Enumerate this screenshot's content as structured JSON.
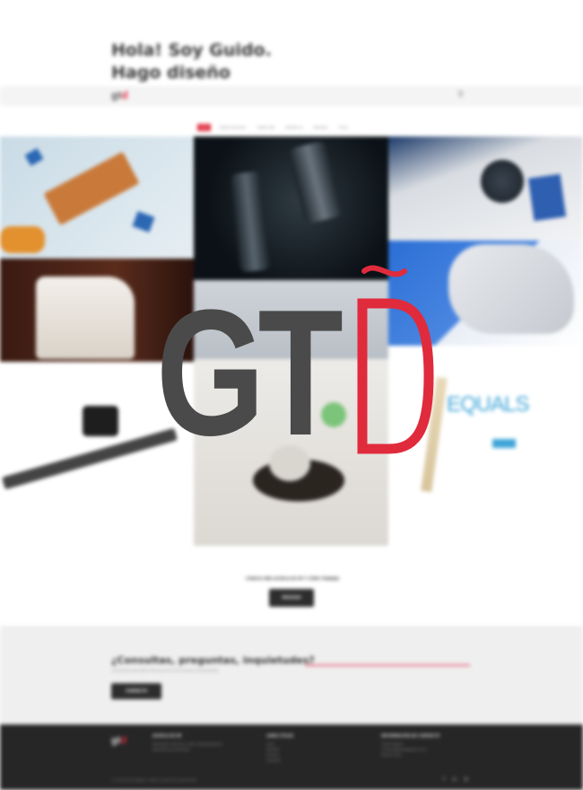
{
  "hero": {
    "line1": "Hola! Soy Guido.",
    "line2": "Hago diseño"
  },
  "navbar": {
    "logo_text": "gt",
    "logo_accent": "d",
    "search_icon": "search-icon"
  },
  "filters": [
    {
      "label": "TODO",
      "active": true
    },
    {
      "label": "DISEÑO INDUSTRIAL",
      "active": false
    },
    {
      "label": "DISEÑO WEB",
      "active": false
    },
    {
      "label": "RENDERS 3D",
      "active": false
    },
    {
      "label": "BRANDING",
      "active": false
    },
    {
      "label": "OTROS",
      "active": false
    }
  ],
  "portfolio": {
    "equals_text": "EQUALS"
  },
  "cta": {
    "text": "CONOCE MÁS ACERCA DE MÍ Y CÓMO TRABAJO",
    "button": "PROCESO"
  },
  "contact": {
    "title": "¿Consultas, preguntas, inquietudes?",
    "subtitle": "Contactame para saber más acerca de mis servicios y presupuestos.",
    "button": "CONTACTO"
  },
  "footer": {
    "logo_text": "gt",
    "logo_accent": "d",
    "col1": {
      "title": "ACERCA DE MÍ",
      "lines": [
        "Diseñador industrial y web, especializado en",
        "desarrollo de productos."
      ]
    },
    "col2": {
      "title": "LINKS ÚTILES",
      "lines": [
        "Inicio",
        "Portfolio",
        "Proceso",
        "Contacto"
      ]
    },
    "col3": {
      "title": "INFORMACIÓN DE CONTACTO",
      "lines": [
        "Guido Tagliani",
        "contacto@guidotagliani.com",
        "Buenos Aires"
      ]
    },
    "copyright": "© 2018 Guido Tagliani. Todos los derechos reservados.",
    "social_icons": [
      "facebook-icon",
      "linkedin-icon",
      "behance-icon"
    ]
  },
  "overlay_logo": {
    "letters": "GT",
    "accent_letter": "Đ",
    "colors": {
      "gray": "#4a4a4a",
      "red": "#e02b3c"
    }
  }
}
